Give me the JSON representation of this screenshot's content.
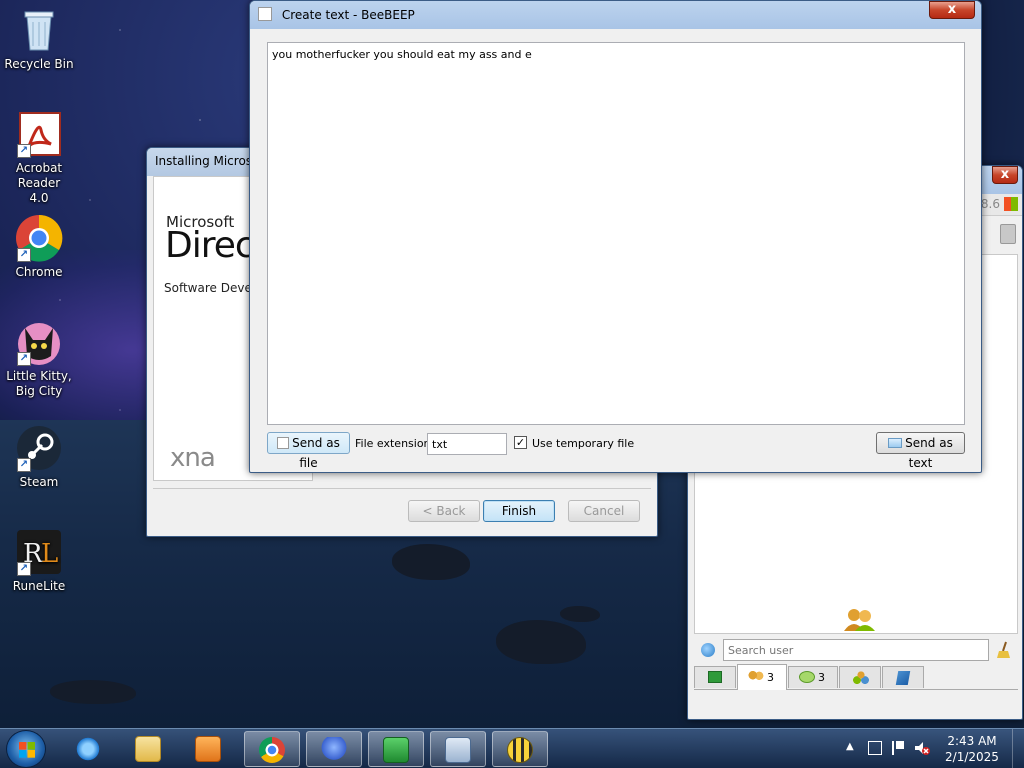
{
  "desktop": {
    "icons": [
      {
        "label": "Recycle Bin"
      },
      {
        "label": "Acrobat Reader 4.0"
      },
      {
        "label": "Chrome"
      },
      {
        "label": "Little Kitty, Big City"
      },
      {
        "label": "Steam"
      },
      {
        "label": "RuneLite"
      }
    ]
  },
  "installer": {
    "title": "Installing Microso",
    "brand_small": "Microsoft",
    "brand_big": "Direc",
    "subtitle": "Software Develc",
    "logo_text": "xna",
    "back_label": "< Back",
    "finish_label": "Finish",
    "cancel_label": "Cancel"
  },
  "create_text": {
    "title": "Create text - BeeBEEP",
    "close_glyph": "x",
    "text_content": "you motherfucker you should eat my ass and e",
    "send_as_file_label": "Send as file",
    "file_extension_label": "File extension",
    "file_extension_value": "txt",
    "use_temp_label": "Use temporary file",
    "use_temp_checked": "✓",
    "send_as_text_label": "Send as text"
  },
  "beebeep_main": {
    "close_glyph": "x",
    "version_fragment": "8.6",
    "search_placeholder": "Search user",
    "tabs": [
      {
        "count": ""
      },
      {
        "count": "3"
      },
      {
        "count": "3"
      },
      {
        "count": ""
      },
      {
        "count": ""
      }
    ]
  },
  "taskbar": {
    "clock_time": "2:43 AM",
    "clock_date": "2/1/2025"
  },
  "colors": {
    "accent": "#3c7fb1",
    "close_red": "#c7452a"
  }
}
